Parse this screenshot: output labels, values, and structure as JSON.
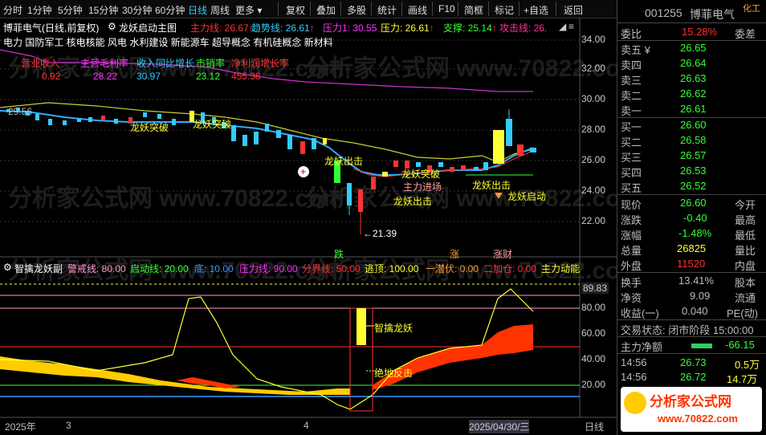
{
  "toolbar": {
    "periods": [
      "分时",
      "1分钟",
      "5分钟",
      "15分钟",
      "30分钟",
      "60分钟",
      "日线",
      "周线",
      "更多"
    ],
    "selected_period": "日线",
    "tools": [
      "复权",
      "叠加",
      "多股",
      "统计",
      "画线",
      "F10",
      "简框",
      "标记",
      "+自选",
      "返回"
    ]
  },
  "main_chart": {
    "stock_label": "博菲电气(日线,前复权)",
    "indicator_name": "龙妖启动主图",
    "indicators": [
      {
        "text": "主力线: 26.67",
        "color": "#ff3333",
        "arrow": "↑"
      },
      {
        "text": "趋势线: 26.61",
        "color": "#33ccff",
        "arrow": "↑"
      },
      {
        "text": "压力1: 30.55",
        "color": "#ff33ff",
        "arrow": ""
      },
      {
        "text": "压力: 26.61",
        "color": "#ffff33",
        "arrow": "↑"
      },
      {
        "text": "支撑: 25.14",
        "color": "#33ff33",
        "arrow": "↑"
      },
      {
        "text": "攻击线: 26.",
        "color": "#ff3399",
        "arrow": ""
      }
    ],
    "sector_line": "电力    国防军工 核电核能 风电 水利建设 新能源车 超导概念 有机硅概念 新材料",
    "fundamentals": {
      "headers": [
        "营业收入",
        "主营毛利率",
        "收入同比增长",
        "市销率",
        "净利润增长率"
      ],
      "values": [
        "0.92",
        "28.22",
        "30.97",
        "23.12",
        "455.38"
      ],
      "colors": [
        "#ff3333",
        "#ff33ff",
        "#33ccff",
        "#33ff33",
        "#ff3333"
      ]
    },
    "y_axis": [
      "34.00",
      "32.00",
      "30.00",
      "28.00",
      "26.00",
      "24.00",
      "22.00"
    ],
    "left_price": "29.56",
    "low_marker": "←21.39",
    "signals": [
      "龙妖突破",
      "龙妖突破",
      "龙妖出击",
      "龙妖突破",
      "主力进场",
      "龙妖出击",
      "龙妖出击",
      "龙妖启动"
    ],
    "top_tags": [
      {
        "text": "跌",
        "color": "#33ff33"
      },
      {
        "text": "涨",
        "color": "#ff9933"
      },
      {
        "text": "涨财",
        "color": "#ff9999"
      }
    ]
  },
  "sub_chart": {
    "name": "智擒龙妖副",
    "params": [
      {
        "text": "警戒线: 80.00",
        "color": "#ff99cc"
      },
      {
        "text": "启动线: 20.00",
        "color": "#33ff33"
      },
      {
        "text": "底: 10.00",
        "color": "#3399ff"
      },
      {
        "text": "压力线: 90.00",
        "color": "#ff33ff"
      },
      {
        "text": "分界线: 50.00",
        "color": "#ff3333"
      },
      {
        "text": "逃顶: 100.00",
        "color": "#ffff33"
      },
      {
        "text": "一潜伏: 0.00",
        "color": "#ff9933"
      },
      {
        "text": "二加仓: 0.00",
        "color": "#ff3333"
      },
      {
        "text": "主力动能",
        "color": "#ffff33"
      }
    ],
    "y_axis": [
      "89.83",
      "80.00",
      "60.00",
      "40.00",
      "20.00"
    ],
    "labels": [
      "智擒龙妖",
      "绝地反击"
    ]
  },
  "x_axis": [
    "2025年",
    "3",
    "4",
    "2025/04/30/三",
    "日线"
  ],
  "right_panel": {
    "code": "001255",
    "name": "博菲电气",
    "corner": "化工",
    "ratio_label": "委比",
    "ratio_value": "15.28%",
    "ratio_side": "委差",
    "asks": [
      {
        "label": "卖五 ¥",
        "price": "26.65"
      },
      {
        "label": "卖四",
        "price": "26.64"
      },
      {
        "label": "卖三",
        "price": "26.63"
      },
      {
        "label": "卖二",
        "price": "26.62"
      },
      {
        "label": "卖一",
        "price": "26.61"
      }
    ],
    "bids": [
      {
        "label": "买一",
        "price": "26.60"
      },
      {
        "label": "买二",
        "price": "26.58"
      },
      {
        "label": "买三",
        "price": "26.57"
      },
      {
        "label": "买四",
        "price": "26.53"
      },
      {
        "label": "买五",
        "price": "26.52"
      }
    ],
    "stats": [
      {
        "label": "现价",
        "value": "26.60",
        "color": "#33ff33",
        "right": "今开"
      },
      {
        "label": "涨跌",
        "value": "-0.40",
        "color": "#33ff33",
        "right": "最高"
      },
      {
        "label": "涨幅",
        "value": "-1.48%",
        "color": "#33ff33",
        "right": "最低"
      },
      {
        "label": "总量",
        "value": "26825",
        "color": "#ffff33",
        "right": "量比"
      },
      {
        "label": "外盘",
        "value": "11520",
        "color": "#ff3333",
        "right": "内盘"
      }
    ],
    "stats2": [
      {
        "label": "换手",
        "value": "13.41%",
        "right": "股本"
      },
      {
        "label": "净资",
        "value": "9.09",
        "right": "流通"
      },
      {
        "label": "收益(一)",
        "value": "0.040",
        "right": "PE(动)"
      }
    ],
    "trade_status": "交易状态: 闭市阶段 15:00:00",
    "net_flow_label": "主力净额",
    "net_flow_value": "-66.15",
    "ticks": [
      {
        "time": "14:56",
        "price": "26.73",
        "vol": "0.5万"
      },
      {
        "time": "14:56",
        "price": "26.72",
        "vol": "14.7万"
      }
    ],
    "banner": "分析家公式网",
    "banner_url": "www.70822.com"
  },
  "watermark": "分析家公式网 www.70822.com"
}
